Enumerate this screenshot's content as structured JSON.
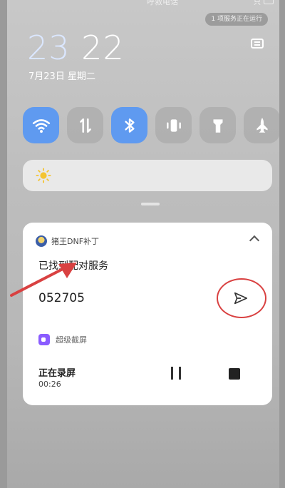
{
  "status": {
    "carrier": "呼救电话",
    "signal": "只"
  },
  "notice_pill": "1 项服务正在运行",
  "clock": {
    "hours": "23",
    "minutes": "22",
    "date": "7月23日 星期二"
  },
  "quick_tiles": [
    {
      "name": "wifi",
      "on": true
    },
    {
      "name": "mobile-data",
      "on": false
    },
    {
      "name": "bluetooth",
      "on": true
    },
    {
      "name": "vibrate",
      "on": false
    },
    {
      "name": "flashlight",
      "on": false
    },
    {
      "name": "airplane",
      "on": false
    }
  ],
  "notification": {
    "app_name": "猪王DNF补丁",
    "message": "已找到配对服务",
    "code": "052705"
  },
  "recorder": {
    "app_name": "超级截屏",
    "status": "正在录屏",
    "duration": "00:26"
  },
  "colors": {
    "tile_on": "#5f9af0",
    "annotation": "#d94141",
    "recorder_icon": "#8a5cff"
  }
}
